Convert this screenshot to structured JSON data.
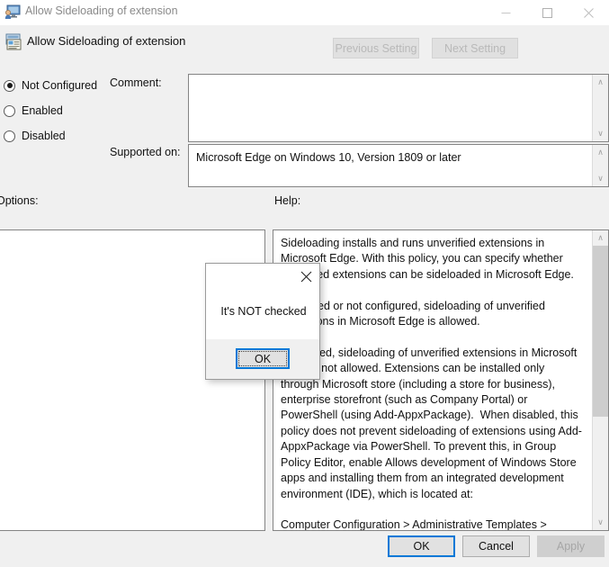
{
  "window": {
    "title": "Allow Sideloading of extension",
    "icon": "policy-computer-icon",
    "minimize_label": "—",
    "maximize_label": "☐",
    "close_label": "✕"
  },
  "header": {
    "title": "Allow Sideloading of extension",
    "icon": "policy-setting-icon",
    "previous_setting_label": "Previous Setting",
    "next_setting_label": "Next Setting"
  },
  "state_options": [
    {
      "label": "Not Configured",
      "selected": true
    },
    {
      "label": "Enabled",
      "selected": false
    },
    {
      "label": "Disabled",
      "selected": false
    }
  ],
  "fields": {
    "comment_label": "Comment:",
    "comment_value": "",
    "supported_on_label": "Supported on:",
    "supported_on_value": "Microsoft Edge on Windows 10, Version 1809 or later"
  },
  "panels": {
    "options_label": "Options:",
    "options_content": "",
    "help_label": "Help:",
    "help_text": "Sideloading installs and runs unverified extensions in Microsoft Edge. With this policy, you can specify whether unverified extensions can be sideloaded in Microsoft Edge.\n\nIf enabled or not configured, sideloading of unverified extensions in Microsoft Edge is allowed.\n\nIf disabled, sideloading of unverified extensions in Microsoft Edge is not allowed. Extensions can be installed only through Microsoft store (including a store for business), enterprise storefront (such as Company Portal) or PowerShell (using Add-AppxPackage).  When disabled, this policy does not prevent sideloading of extensions using Add-AppxPackage via PowerShell. To prevent this, in Group Policy Editor, enable Allows development of Windows Store apps and installing them from an integrated development environment (IDE), which is located at:\n\nComputer Configuration > Administrative Templates > Windows Components > App Package Deployment\n\nSupported on: Microsoft Edge on Windows 10, Version 1809"
  },
  "footer": {
    "ok_label": "OK",
    "cancel_label": "Cancel",
    "apply_label": "Apply"
  },
  "modal": {
    "message": "It's NOT checked",
    "ok_label": "OK",
    "close_label": "✕"
  },
  "scrollbars": {
    "up_arrow": "∧",
    "down_arrow": "∨"
  },
  "colors": {
    "accent": "#0078d7",
    "window_bg": "#f0f0f0",
    "field_border": "#848484",
    "disabled_text": "#b9b9b9"
  }
}
